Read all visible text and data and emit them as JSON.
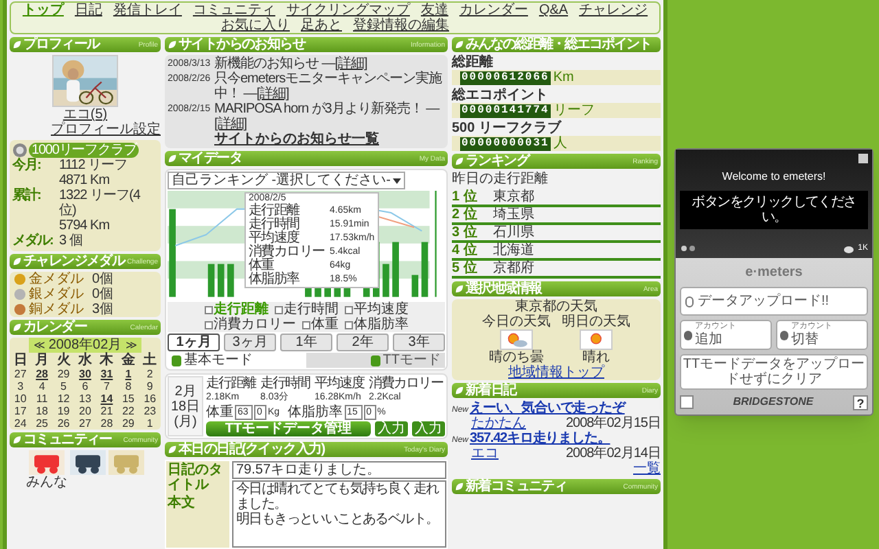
{
  "nav": [
    {
      "label": "トップ",
      "selected": true
    },
    {
      "label": "日記",
      "selected": false
    },
    {
      "label": "発信トレイ",
      "selected": false
    },
    {
      "label": "コミュニティ",
      "selected": false
    },
    {
      "label": "サイクリングマップ",
      "selected": false
    },
    {
      "label": "友達",
      "selected": false
    },
    {
      "label": "カレンダー",
      "selected": false
    },
    {
      "label": "Q&A",
      "selected": false
    },
    {
      "label": "チャレンジ",
      "selected": false
    },
    {
      "label": "お気に入り",
      "selected": false
    },
    {
      "label": "足あと",
      "selected": false
    },
    {
      "label": "登録情報の編集",
      "selected": false
    }
  ],
  "profile": {
    "title": "プロフィール",
    "subtitle": "Profile",
    "photo": {
      "kind": "picture"
    },
    "name": "エコ(5)",
    "settings_link": "プロフィール設定"
  },
  "leaf_club": {
    "badge": "1000リーフクラブ",
    "rows": [
      {
        "label": "今月:",
        "values": [
          "1112 リーフ",
          "4871 Km"
        ]
      },
      {
        "label": "累計:",
        "values": [
          "1322 リーフ(4 位)",
          "5794 Km"
        ]
      },
      {
        "label": "メダル:",
        "values": [
          "3 個"
        ]
      }
    ]
  },
  "medals": {
    "title": "チャレンジメダル",
    "subtitle": "Challenge",
    "items": [
      {
        "label": "金メダル",
        "count": "0個",
        "color": "#d9a21b"
      },
      {
        "label": "銀メダル",
        "count": "0個",
        "color": "#b4b4b4"
      },
      {
        "label": "銅メダル",
        "count": "3個",
        "color": "#c47a3c"
      }
    ]
  },
  "calendar": {
    "title": "カレンダー",
    "subtitle": "Calendar",
    "prev": "≪",
    "month": "2008年02月",
    "next": "≫",
    "weekdays": [
      "日",
      "月",
      "火",
      "水",
      "木",
      "金",
      "土"
    ],
    "weeks": [
      [
        {
          "day": "27",
          "linked": false
        },
        {
          "day": "28",
          "linked": true
        },
        {
          "day": "29",
          "linked": false
        },
        {
          "day": "30",
          "linked": true
        },
        {
          "day": "31",
          "linked": true
        },
        {
          "day": "1",
          "linked": true
        },
        {
          "day": "2",
          "linked": false
        }
      ],
      [
        {
          "day": "3",
          "linked": false
        },
        {
          "day": "4",
          "linked": false
        },
        {
          "day": "5",
          "linked": false
        },
        {
          "day": "6",
          "linked": false
        },
        {
          "day": "7",
          "linked": false
        },
        {
          "day": "8",
          "linked": false
        },
        {
          "day": "9",
          "linked": false
        }
      ],
      [
        {
          "day": "10",
          "linked": false
        },
        {
          "day": "11",
          "linked": false
        },
        {
          "day": "12",
          "linked": false
        },
        {
          "day": "13",
          "linked": false
        },
        {
          "day": "14",
          "linked": true
        },
        {
          "day": "15",
          "linked": false
        },
        {
          "day": "16",
          "linked": false
        }
      ],
      [
        {
          "day": "17",
          "linked": false
        },
        {
          "day": "18",
          "linked": false
        },
        {
          "day": "19",
          "linked": false
        },
        {
          "day": "20",
          "linked": false
        },
        {
          "day": "21",
          "linked": false
        },
        {
          "day": "22",
          "linked": false
        },
        {
          "day": "23",
          "linked": false
        }
      ],
      [
        {
          "day": "24",
          "linked": false
        },
        {
          "day": "25",
          "linked": false
        },
        {
          "day": "26",
          "linked": false
        },
        {
          "day": "27",
          "linked": false
        },
        {
          "day": "28",
          "linked": false
        },
        {
          "day": "29",
          "linked": false
        },
        {
          "day": "1",
          "linked": false
        }
      ]
    ]
  },
  "community": {
    "title": "コミュニティー",
    "subtitle": "Community",
    "tiles": [
      {
        "kind": "picture",
        "label": "みんな"
      },
      {
        "kind": "picture"
      },
      {
        "kind": "picture"
      }
    ]
  },
  "news": {
    "title": "サイトからのお知らせ",
    "subtitle": "Information",
    "items": [
      {
        "date": "2008/3/13",
        "text": "新機能のお知らせ —",
        "link": "[詳細]"
      },
      {
        "date": "2008/2/26",
        "text": "只今emetersモニターキャンペーン実施中！ —",
        "link": "[詳細]"
      },
      {
        "date": "2008/2/15",
        "text": "MARIPOSA horn が3月より新発売！ —",
        "link": "[詳細]"
      }
    ],
    "more": "サイトからのお知らせ一覧"
  },
  "mydata": {
    "title": "マイデータ",
    "subtitle": "My Data",
    "select": "自己ランキング -選択してください-",
    "tooltip": {
      "date": "2008/2/5",
      "rows": [
        {
          "label": "走行距離",
          "value": "4.65km"
        },
        {
          "label": "走行時間",
          "value": "15.91min"
        },
        {
          "label": "平均速度",
          "value": "17.53km/h"
        },
        {
          "label": "消費カロリー",
          "value": "5.4kcal"
        },
        {
          "label": "体重",
          "value": "64kg"
        },
        {
          "label": "体脂肪率",
          "value": "18.5%"
        }
      ]
    },
    "toggles": [
      {
        "label": "走行距離",
        "active": true
      },
      {
        "label": "走行時間",
        "active": false
      },
      {
        "label": "平均速度",
        "active": false
      },
      {
        "label": "消費カロリー",
        "active": false
      },
      {
        "label": "体重",
        "active": false
      },
      {
        "label": "体脂肪率",
        "active": false
      }
    ],
    "periods": [
      {
        "label": "1ヶ月",
        "selected": true
      },
      {
        "label": "3ヶ月",
        "selected": false
      },
      {
        "label": "1年",
        "selected": false
      },
      {
        "label": "2年",
        "selected": false
      },
      {
        "label": "3年",
        "selected": false
      }
    ],
    "modes": [
      {
        "label": "基本モード",
        "selected": true
      },
      {
        "label": "TTモード",
        "selected": false
      }
    ],
    "summary": {
      "date": "2月18日",
      "weekday": "(月)",
      "stats": [
        {
          "label": "走行距離",
          "value": "2.18Km"
        },
        {
          "label": "走行時間",
          "value": "8.03分"
        },
        {
          "label": "平均速度",
          "value": "16.28Km/h"
        },
        {
          "label": "消費カロリー",
          "value": "2.2Kcal"
        }
      ],
      "measures": [
        {
          "label": "体重",
          "whole": "63",
          "decimal": "0",
          "unit": "Kg",
          "button": "入力"
        },
        {
          "label": "体脂肪率",
          "whole": "15",
          "decimal": "0",
          "unit": "%",
          "button": "入力"
        }
      ],
      "manage_button": "TTモードデータ管理"
    }
  },
  "diary": {
    "title": "本日の日記(クイック入力)",
    "subtitle": "Today's Diary",
    "title_label": "日記のタイトル",
    "title_value": "79.57キロ走りました。",
    "body_label": "本文",
    "body_lines": [
      "今日は晴れてとても気持ち良く走れました。",
      "明日もきっといいことあるベルト。"
    ]
  },
  "totals": {
    "title": "みんなの総距離・総エコポイント",
    "items": [
      {
        "label": "総距離",
        "value": "00000612066",
        "unit": "Km"
      },
      {
        "label": "総エコポイント",
        "value": "00000141774",
        "unit": "リーフ"
      },
      {
        "label": "500 リーフクラブ",
        "value": "00000000031",
        "unit": "人"
      }
    ]
  },
  "ranking": {
    "title": "ランキング",
    "subtitle": "Ranking",
    "caption": "昨日の走行距離",
    "items": [
      {
        "rank": "1 位",
        "name": "東京都"
      },
      {
        "rank": "2 位",
        "name": "埼玉県"
      },
      {
        "rank": "3 位",
        "name": "石川県"
      },
      {
        "rank": "4 位",
        "name": "北海道"
      },
      {
        "rank": "5 位",
        "name": "京都府"
      }
    ]
  },
  "area": {
    "title": "選択地域情報",
    "subtitle": "Area",
    "heading": "東京都の天気",
    "days": [
      {
        "label": "今日の天気",
        "weather": "晴のち曇",
        "kind": "sun-cloud"
      },
      {
        "label": "明日の天気",
        "weather": "晴れ",
        "kind": "sun"
      }
    ],
    "link": "地域情報トップ"
  },
  "new_diaries": {
    "title": "新着日記",
    "subtitle": "Diary",
    "items": [
      {
        "badge": "New",
        "title": "えーい、気合いで走ったぞ",
        "author": "たかたん",
        "date": "2008年02月15日"
      },
      {
        "badge": "New",
        "title": "357.42キロ走りました。",
        "author": "エコ",
        "date": "2008年02月14日"
      }
    ],
    "more": "一覧"
  },
  "new_community": {
    "title": "新着コミュニティ",
    "subtitle": "Community"
  },
  "widget": {
    "welcome": "Welcome to emeters!",
    "message": "ボタンをクリックしてください。",
    "counter": "1K",
    "brand": "e·meters",
    "upload": "データアップロード!!",
    "accounts": [
      {
        "small": "アカウント",
        "big": "追加"
      },
      {
        "small": "アカウント",
        "big": "切替"
      }
    ],
    "clear": "TTモードデータをアップロードせずにクリア",
    "maker": "BRIDGESTONE",
    "help": "?"
  }
}
